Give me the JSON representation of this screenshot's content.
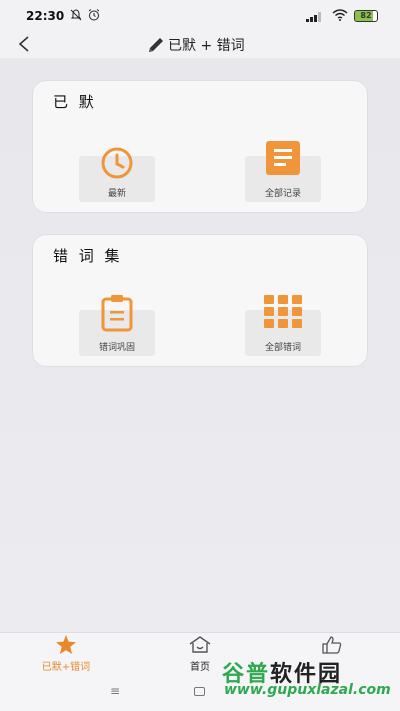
{
  "status_bar": {
    "time": "22:30",
    "battery": "82",
    "icons": [
      "notification-off-icon",
      "alarm-icon",
      "signal-icon",
      "wifi-icon",
      "battery-icon"
    ]
  },
  "header": {
    "title": "已默 + 错词",
    "back_icon": "chevron-left-icon",
    "title_icon": "pencil-icon"
  },
  "sections": [
    {
      "title": "已 默",
      "tiles": [
        {
          "label": "最新",
          "icon": "clock-icon"
        },
        {
          "label": "全部记录",
          "icon": "document-icon"
        }
      ]
    },
    {
      "title": "错 词 集",
      "tiles": [
        {
          "label": "错词巩固",
          "icon": "clipboard-icon"
        },
        {
          "label": "全部错词",
          "icon": "grid-icon"
        }
      ]
    }
  ],
  "bottom_nav": {
    "items": [
      {
        "label": "已默+错词",
        "icon": "star-icon",
        "active": true
      },
      {
        "label": "首页",
        "icon": "house-icon",
        "active": false
      },
      {
        "label": "",
        "icon": "thumbs-up-icon",
        "active": false
      }
    ]
  },
  "watermark": {
    "text_green": "谷普",
    "text_dark": "软件园",
    "url": "www.gupuxlazal.com"
  },
  "colors": {
    "accent": "#f0953a",
    "active_tab": "#e8892d",
    "watermark_green": "#2fa84f"
  }
}
